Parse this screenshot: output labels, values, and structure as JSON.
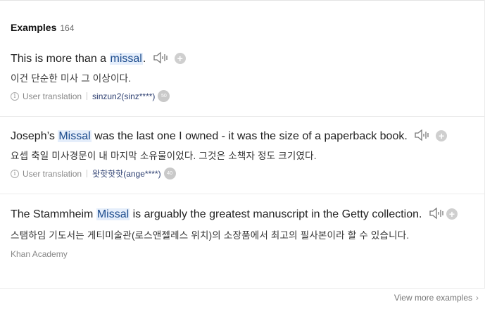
{
  "header": {
    "title": "Examples",
    "count": "164"
  },
  "examples": [
    {
      "before": "This is more than a ",
      "highlight": "missal",
      "after": ".",
      "translation": "이건 단순한 미사 그 이상이다.",
      "source_type": "User translation",
      "user": "sinzun2(sinz****)",
      "badge": "50"
    },
    {
      "before": "Joseph’s ",
      "highlight": "Missal",
      "after": " was the last one I owned - it was the size of a paperback book.",
      "translation": "요셉 축일 미사경문이 내 마지막 소유물이었다. 그것은 소책자 정도 크기였다.",
      "source_type": "User translation",
      "user": "왓핫핫핫(ange****)",
      "badge": "40"
    },
    {
      "before": "The Stammheim ",
      "highlight": "Missal",
      "after": " is arguably the greatest manuscript in the Getty collection.",
      "translation": "스탬하임 기도서는 게티미술관(로스앤젤레스 위치)의 소장품에서 최고의 필사본이라 할 수 있습니다.",
      "source": "Khan Academy"
    }
  ],
  "footer": {
    "view_more": "View more examples"
  },
  "icons": {
    "speaker": "speaker-icon",
    "plus": "add-icon",
    "info": "info-icon",
    "chevron": "chevron-right-icon"
  }
}
